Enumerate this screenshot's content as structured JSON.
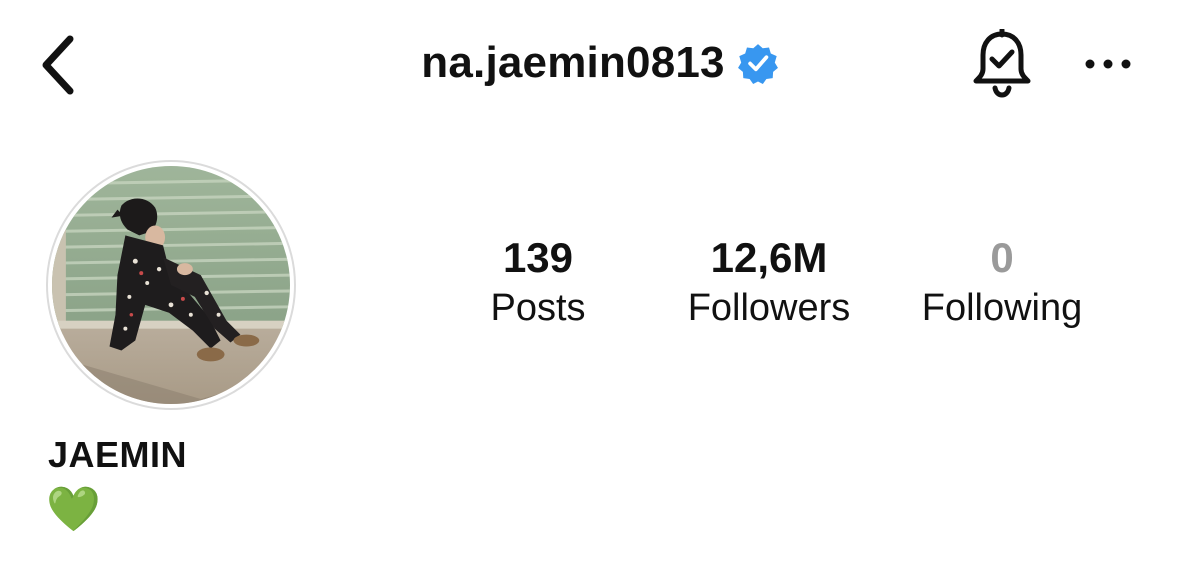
{
  "header": {
    "username": "na.jaemin0813",
    "verified": true,
    "icons": {
      "back": "chevron-left-icon",
      "verified": "verified-badge-icon",
      "notifications": "bell-check-icon",
      "more": "more-horizontal-icon"
    }
  },
  "profile": {
    "avatar": "profile-photo",
    "stats": [
      {
        "value": "139",
        "label": "Posts"
      },
      {
        "value": "12,6M",
        "label": "Followers"
      },
      {
        "value": "0",
        "label": "Following"
      }
    ],
    "display_name": "JAEMIN",
    "bio": "💚"
  },
  "colors": {
    "verified_blue": "#3897f0",
    "muted_count": "#9a9a9a",
    "text": "#111111",
    "avatar_ring": "#dbdbdb",
    "heart_green": "#5cc24a"
  }
}
